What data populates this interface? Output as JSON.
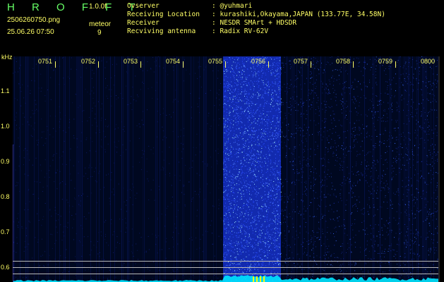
{
  "header": {
    "app_name": "H R O F F T",
    "version": "1.0.0f",
    "filename": "2506260750.png",
    "datetime": "25.06.26 07:50",
    "meteor_label": "meteor",
    "meteor_count": "9"
  },
  "info": [
    {
      "label": "Ovserver",
      "value": ": @yuhmari"
    },
    {
      "label": "Receiving Location",
      "value": ": kurashiki,Okayama,JAPAN (133.77E, 34.58N)"
    },
    {
      "label": "Receiver",
      "value": ": NESDR SMArt + HDSDR"
    },
    {
      "label": "Recviving antenna",
      "value": ": Radix RV-62V"
    }
  ],
  "axes": {
    "y_unit": "kHz",
    "y_ticks": [
      "1.1",
      "1.0",
      "0.9",
      "0.8",
      "0.7",
      "0.6"
    ],
    "x_ticks": [
      "0751",
      "0752",
      "0753",
      "0754",
      "0755",
      "0756",
      "0757",
      "0758",
      "0759",
      "0800"
    ]
  },
  "colors": {
    "text": "#ffff66",
    "title": "#66ff66",
    "noise_band": "#2a4cff",
    "background": "#000820",
    "baseline": "#00e5ff",
    "marker": "#ffff00"
  }
}
